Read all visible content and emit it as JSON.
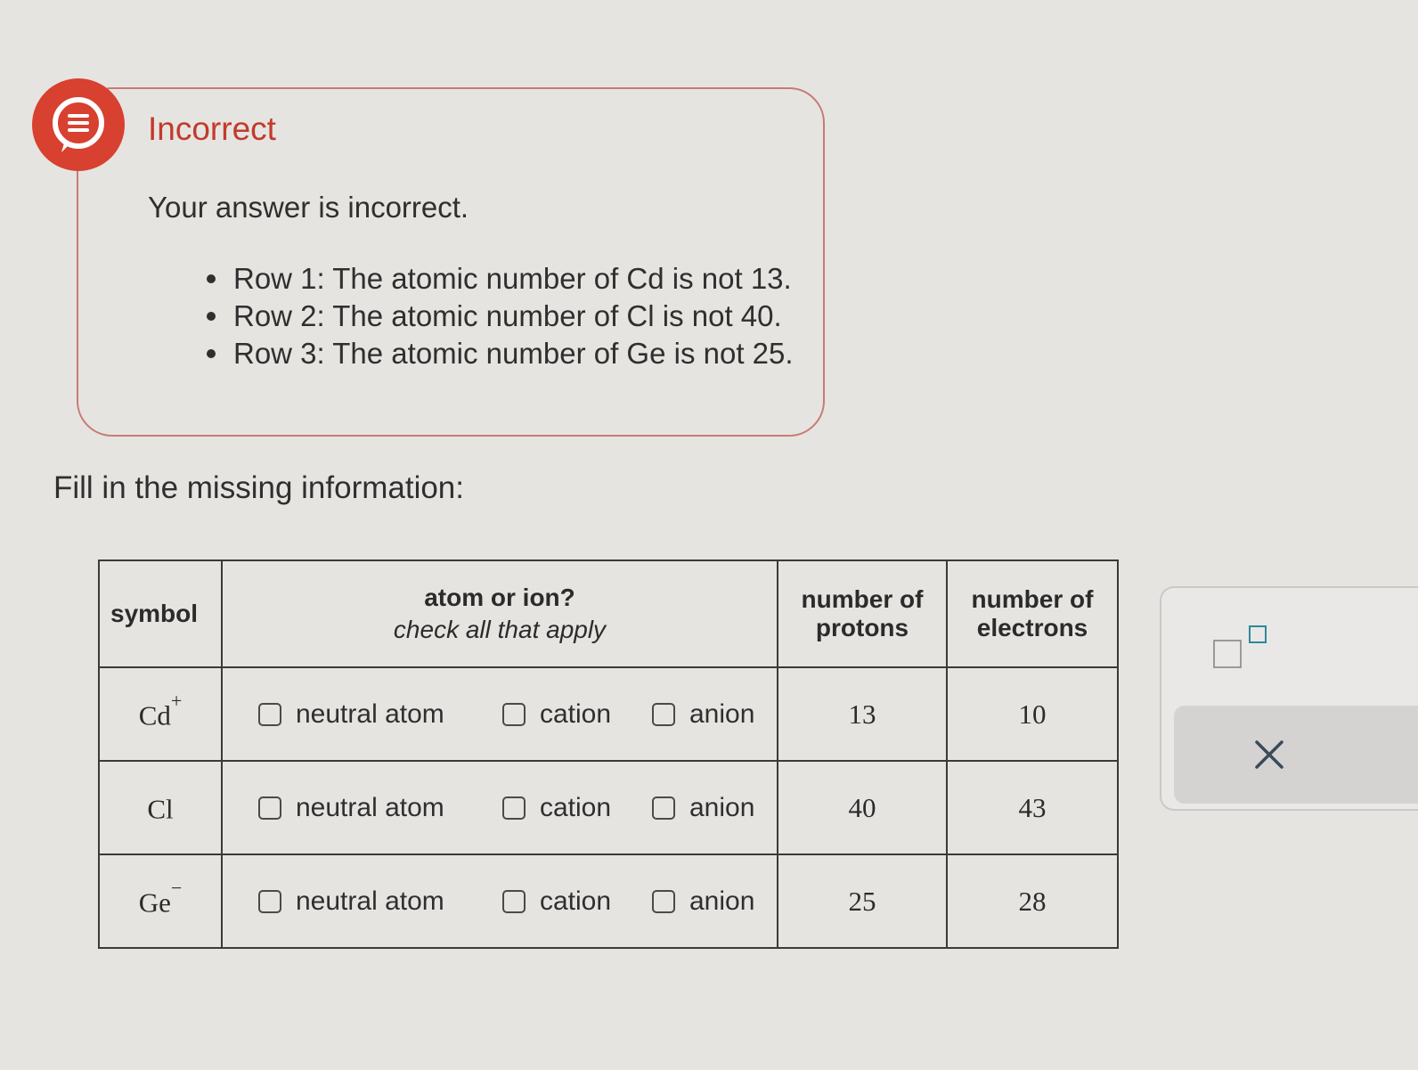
{
  "feedback": {
    "title": "Incorrect",
    "message": "Your answer is incorrect.",
    "items": [
      "Row 1: The atomic number of Cd is not 13.",
      "Row 2: The atomic number of Cl is not 40.",
      "Row 3: The atomic number of Ge is not 25."
    ],
    "icon": "chat-bubble-icon",
    "accent_color": "#d8402f"
  },
  "instruction": "Fill in the missing information:",
  "table": {
    "headers": {
      "symbol": "symbol",
      "atom_or_ion": "atom or ion?",
      "atom_or_ion_sub": "check all that apply",
      "protons": "number of protons",
      "electrons": "number of electrons"
    },
    "option_labels": {
      "neutral": "neutral atom",
      "cation": "cation",
      "anion": "anion"
    },
    "rows": [
      {
        "element": "Cd",
        "charge": "+",
        "protons": "13",
        "electrons": "10"
      },
      {
        "element": "Cl",
        "charge": "",
        "protons": "40",
        "electrons": "43"
      },
      {
        "element": "Ge",
        "charge": "−",
        "protons": "25",
        "electrons": "28"
      }
    ]
  },
  "side_panel": {
    "superscript_icon": "superscript-icon",
    "clear_icon": "close-icon",
    "clear_symbol": "×"
  }
}
